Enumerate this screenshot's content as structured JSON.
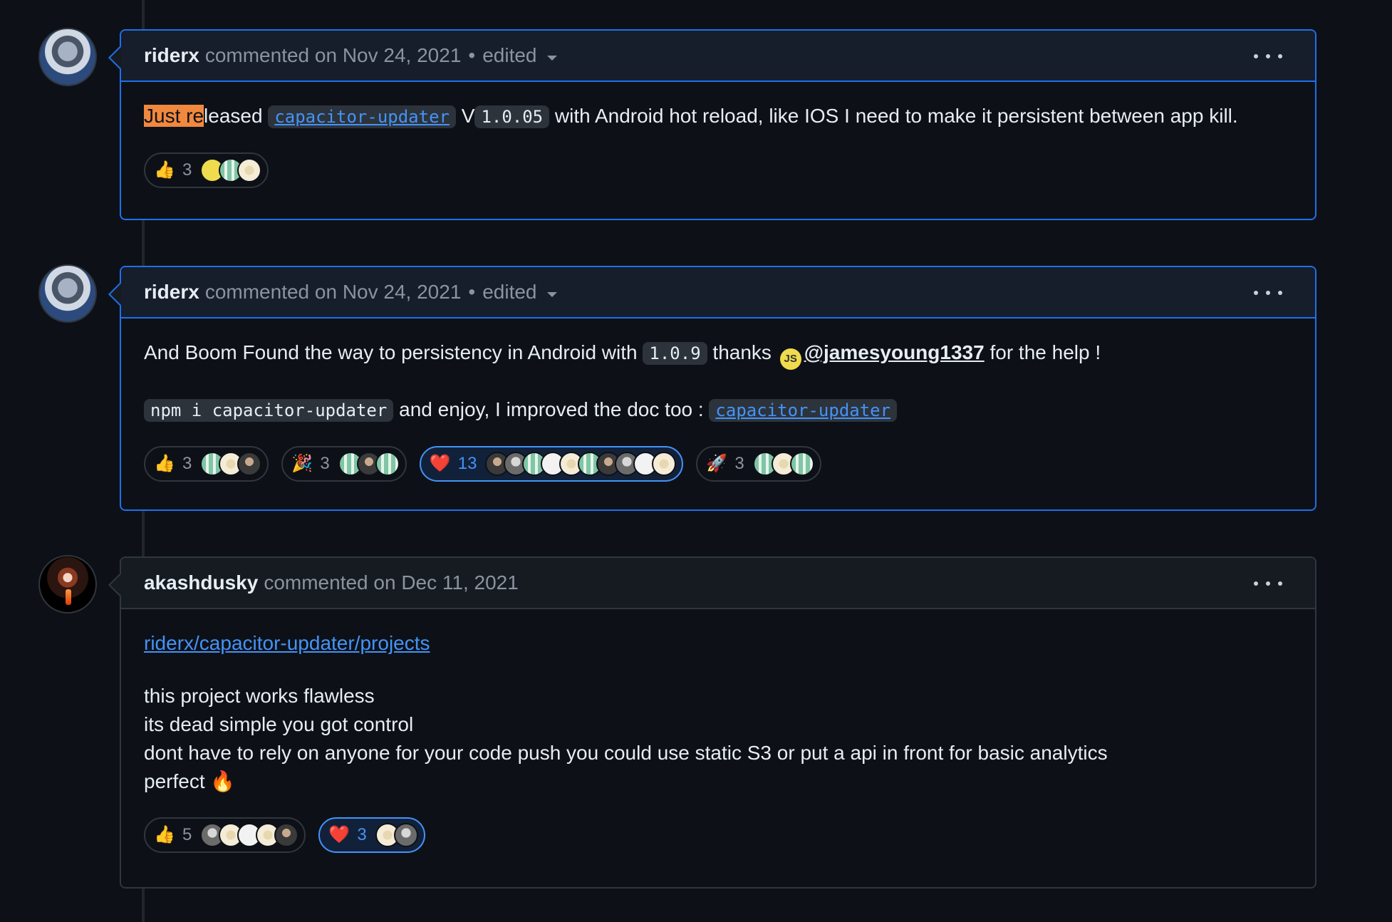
{
  "comments": [
    {
      "author": "riderx",
      "meta": "commented on Nov 24, 2021",
      "edited": "edited",
      "body": {
        "highlight": "Just re",
        "text1": "leased ",
        "code1": "capacitor-updater",
        "text2": " V",
        "code2": "1.0.05",
        "text3": " with Android hot reload, like IOS I need to make it persistent between app kill."
      },
      "reactions": [
        {
          "emoji": "👍",
          "count": "3"
        }
      ]
    },
    {
      "author": "riderx",
      "meta": "commented on Nov 24, 2021",
      "edited": "edited",
      "body": {
        "text1": "And Boom Found the way to persistency in Android with ",
        "code1": "1.0.9",
        "text2": " thanks ",
        "mention_icon": "JS",
        "mention": "@jamesyoung1337",
        "text3": " for the help !",
        "code2": "npm i capacitor-updater",
        "text4": " and enjoy, I improved the doc too : ",
        "code3": "capacitor-updater"
      },
      "reactions": [
        {
          "emoji": "👍",
          "count": "3"
        },
        {
          "emoji": "🎉",
          "count": "3"
        },
        {
          "emoji": "❤️",
          "count": "13"
        },
        {
          "emoji": "🚀",
          "count": "3"
        }
      ]
    },
    {
      "author": "akashdusky",
      "meta": "commented on Dec 11, 2021",
      "body": {
        "link": "riderx/capacitor-updater/projects",
        "line1": "this project works flawless",
        "line2": "its dead simple you got control",
        "line3": "dont have to rely on anyone for your code push you could use static S3 or put a api in front for basic analytics",
        "line4": "perfect 🔥"
      },
      "reactions": [
        {
          "emoji": "👍",
          "count": "5"
        },
        {
          "emoji": "❤️",
          "count": "3"
        }
      ]
    }
  ],
  "icons": {
    "kebab": "kebab-horizontal-icon",
    "caret": "triangle-down-icon"
  },
  "colors": {
    "background": "#0d1117",
    "accent_border": "#1f6feb",
    "link": "#4493f8",
    "highlight": "#f0883e"
  }
}
